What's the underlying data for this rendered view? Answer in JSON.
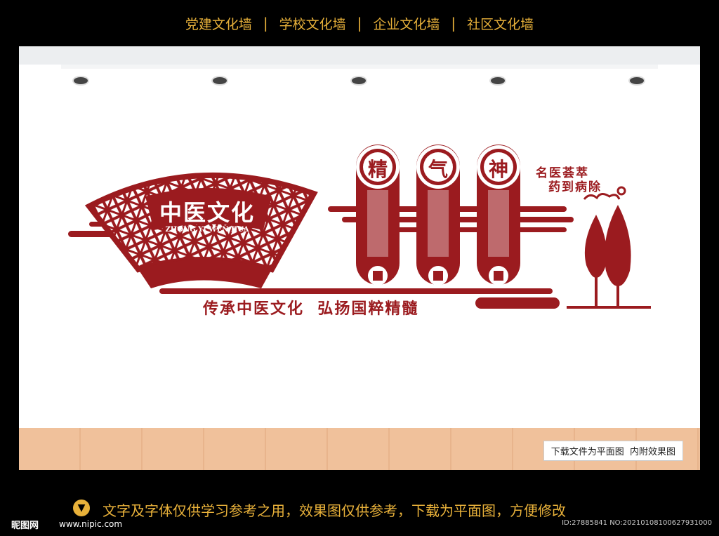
{
  "nav": {
    "items": [
      "党建文化墙",
      "学校文化墙",
      "企业文化墙",
      "社区文化墙"
    ],
    "separator": "|"
  },
  "fan": {
    "title": "中医文化",
    "subtitle": "ZHONG YI WEN HUA"
  },
  "pillars": [
    {
      "char": "精"
    },
    {
      "char": "气"
    },
    {
      "char": "神"
    }
  ],
  "side_text": {
    "line1": "名医荟萃",
    "line2": "药到病除"
  },
  "slogan": "传承中医文化  弘扬国粹精髓",
  "overlay_note": "下载文件为平面图  内附效果图",
  "footer": {
    "notice": "文字及字体仅供学习参考之用，效果图仅供参考，下载为平面图，方便修改",
    "site_name": "昵图网",
    "site_url": "www.nipic.com",
    "id_line": "ID:27885841 NO:20210108100627931000"
  },
  "colors": {
    "wall_red": "#9b1b1f",
    "accent_gold": "#e8b13a",
    "floor": "#f0c19b",
    "background": "#000000"
  }
}
